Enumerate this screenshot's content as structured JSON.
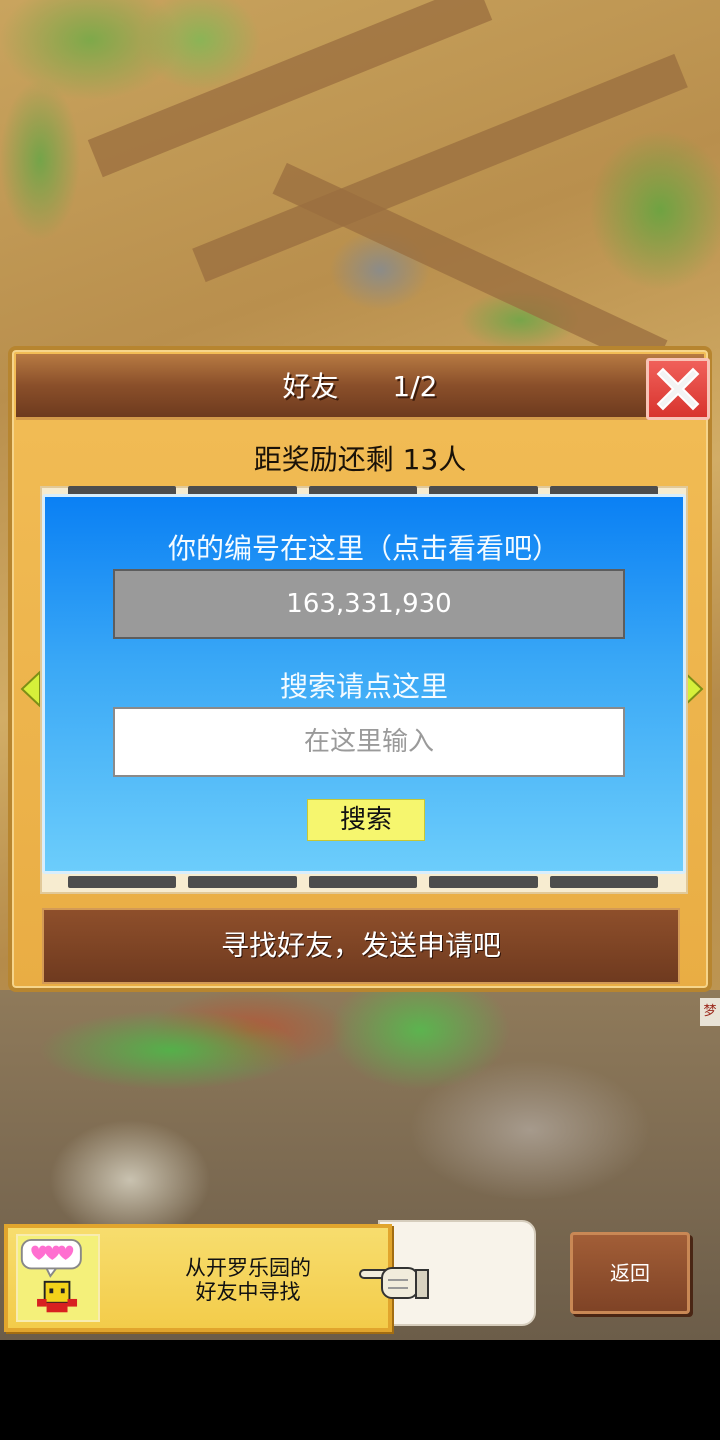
{
  "dialog": {
    "title": "好友",
    "page": "1/2",
    "reward_status": "距奖励还剩 13人"
  },
  "id_panel": {
    "id_label": "你的编号在这里（点击看看吧）",
    "player_id": "163,331,930",
    "search_label": "搜索请点这里",
    "search_placeholder": "在这里输入",
    "search_value": "",
    "search_button": "搜索"
  },
  "find_button": "寻找好友，发送申请吧",
  "side_tag": "梦",
  "kairo_banner": {
    "line1": "从开罗乐园的",
    "line2": "好友中寻找"
  },
  "back_button": "返回",
  "icons": {
    "close": "close-icon",
    "prev": "arrow-left-icon",
    "next": "arrow-right-icon",
    "mascot": "kairobot-icon",
    "hand": "pointing-hand-icon"
  },
  "colors": {
    "panel_blue": "#0a80f4",
    "close_red": "#d8342e",
    "search_yellow": "#f6f66e",
    "dialog_orange": "#f2bd56"
  }
}
